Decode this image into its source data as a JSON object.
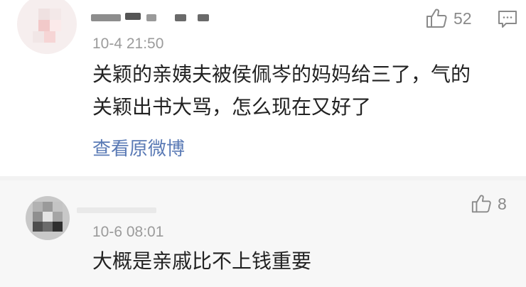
{
  "comments": [
    {
      "time": "10-4 21:50",
      "lines": [
        "关颖的亲姨夫被侯佩岑的妈妈给三了，气的",
        "关颖出书大骂，怎么现在又好了"
      ],
      "likes": "52",
      "link_label": "查看原微博"
    },
    {
      "time": "10-6 08:01",
      "lines": [
        "大概是亲戚比不上钱重要"
      ],
      "likes": "8"
    }
  ],
  "icons": {
    "like": "thumbs-up-icon",
    "reply": "comment-icon"
  },
  "colors": {
    "text": "#222222",
    "meta": "#9b9b9b",
    "link": "#5a7ab5",
    "second_bg": "#f7f7f7"
  }
}
